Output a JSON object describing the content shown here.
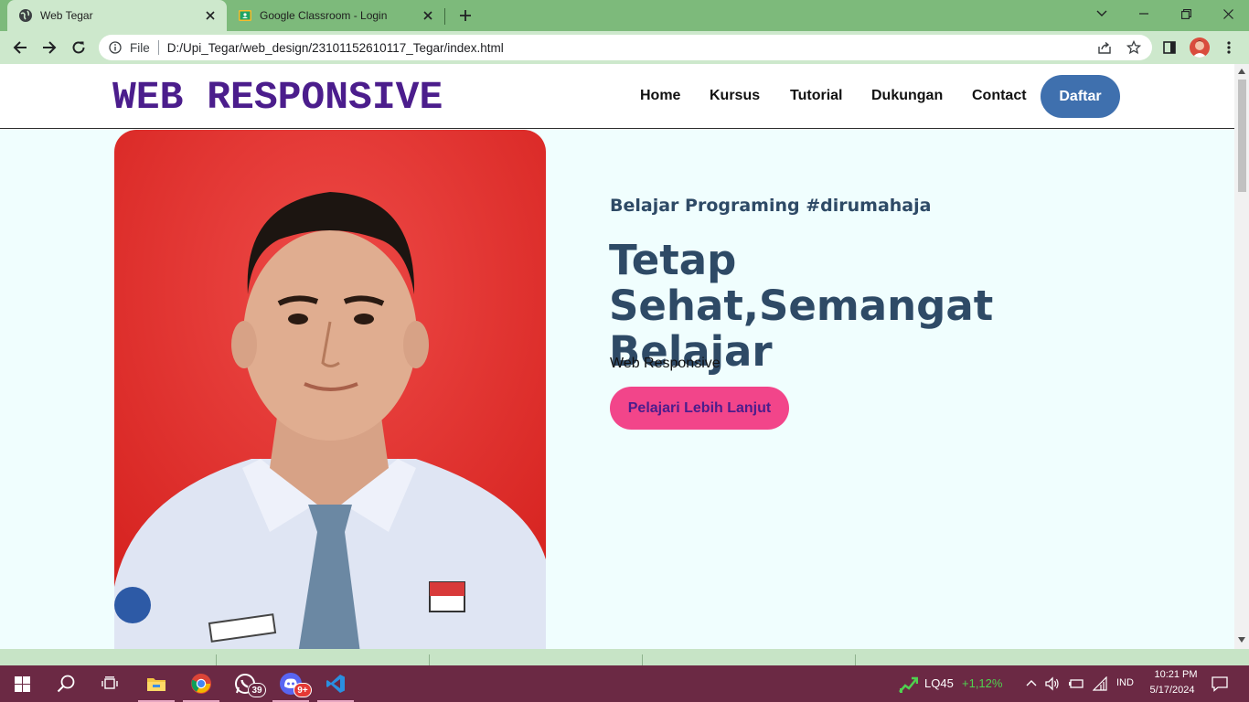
{
  "browser": {
    "tabs": [
      {
        "title": "Web Tegar",
        "icon": "globe-icon",
        "active": true
      },
      {
        "title": "Google Classroom - Login",
        "icon": "google-classroom-icon",
        "active": false
      }
    ],
    "address": {
      "scheme_label": "File",
      "url": "D:/Upi_Tegar/web_design/23101152610117_Tegar/index.html"
    },
    "colors": {
      "frame": "#7dba7b",
      "toolbar": "#cde8cc"
    }
  },
  "page": {
    "brand": "WEB RESPONSIVE",
    "nav": [
      {
        "label": "Home"
      },
      {
        "label": "Kursus"
      },
      {
        "label": "Tutorial"
      },
      {
        "label": "Dukungan"
      },
      {
        "label": "Contact"
      }
    ],
    "nav_cta": "Daftar",
    "hero": {
      "subtitle": "Belajar Programing #dirumahaja",
      "headline": "Tetap Sehat,Semangat Belajar",
      "description": "Web Responsive",
      "cta": "Pelajari Lebih Lanjut",
      "photo": "portrait-photo"
    },
    "colors": {
      "brand": "#4b1d8c",
      "daftar_bg": "#3f70ae",
      "cta_bg": "#f2458a",
      "heading": "#2e4a66",
      "page_bg": "#f0fefe"
    }
  },
  "taskbar": {
    "apps": [
      {
        "name": "file-explorer-icon",
        "badge": ""
      },
      {
        "name": "chrome-icon",
        "badge": ""
      },
      {
        "name": "whatsapp-icon",
        "badge": "39"
      },
      {
        "name": "discord-icon",
        "badge": "9+"
      },
      {
        "name": "vscode-icon",
        "badge": ""
      }
    ],
    "ticker": {
      "name": "LQ45",
      "change": "+1,12%"
    },
    "language": "IND",
    "time": "10:21 PM",
    "date": "5/17/2024",
    "color": "#6b2944"
  }
}
